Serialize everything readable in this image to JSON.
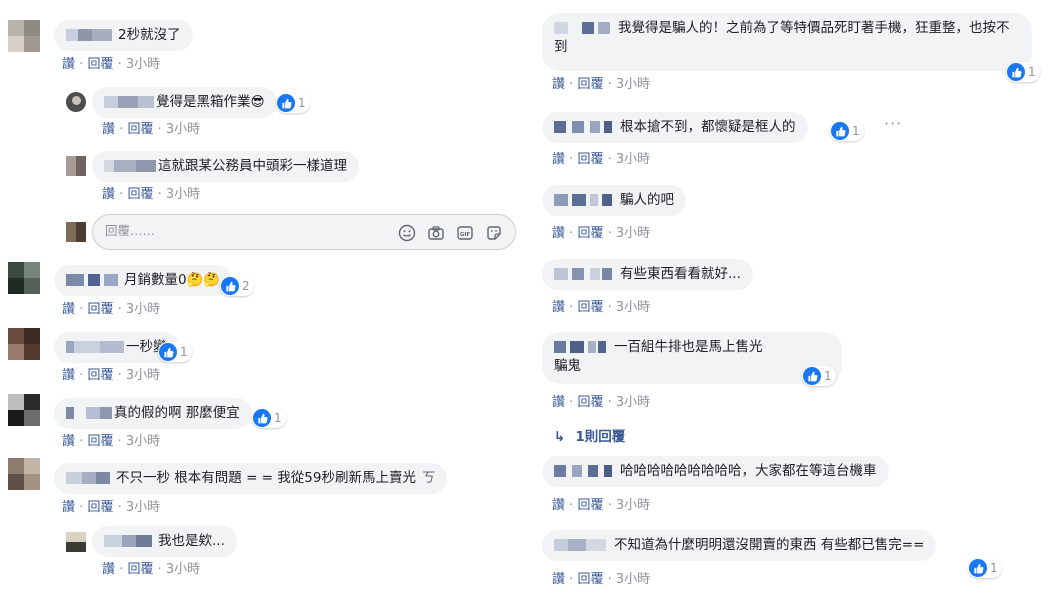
{
  "labels": {
    "like": "讚",
    "reply": "回覆",
    "sep": "·"
  },
  "reply_input": {
    "placeholder": "回覆……"
  },
  "left": [
    {
      "text": "2秒就沒了",
      "time": "3小時",
      "reactions": ""
    },
    {
      "text": "覺得是黑箱作業😎",
      "time": "3小時",
      "reactions": "1"
    },
    {
      "text": "這就跟某公務員中頭彩一樣道理",
      "time": "3小時",
      "reactions": ""
    },
    {
      "text": "月銷數量0🤔🤔",
      "time": "3小時",
      "reactions": "2"
    },
    {
      "text": "一秒變",
      "time": "3小時",
      "reactions": "1"
    },
    {
      "text": "真的假的啊 那麼便宜",
      "time": "3小時",
      "reactions": "1"
    },
    {
      "text": "不只一秒 根本有問題 = = 我從59秒刷新馬上賣光",
      "time": "3小時",
      "reactions": ""
    },
    {
      "text": "我也是欸...",
      "time": "3小時",
      "reactions": ""
    }
  ],
  "right": [
    {
      "text": "我覺得是騙人的！之前為了等特價品死盯著手機，狂重整，也按不到",
      "time": "3小時",
      "reactions": "1"
    },
    {
      "text": "根本搶不到，都懷疑是框人的",
      "time": "3小時",
      "reactions": "1"
    },
    {
      "text": "騙人的吧",
      "time": "3小時",
      "reactions": ""
    },
    {
      "text": "有些東西看看就好...",
      "time": "3小時",
      "reactions": ""
    },
    {
      "text": "一百組牛排也是馬上售光",
      "text2": "騙鬼",
      "time": "3小時",
      "reactions": "1"
    },
    {
      "text": "哈哈哈哈哈哈哈哈哈，大家都在等這台機車",
      "time": "3小時",
      "reactions": ""
    },
    {
      "text": "不知道為什麼明明還沒開賣的東西 有些都已售完==",
      "time": "3小時",
      "reactions": "1"
    }
  ],
  "replies_link": "1則回覆",
  "colors": {
    "link": "#385898",
    "meta": "#90949c",
    "bubble": "#f2f3f5",
    "like_blue": "#1877f2"
  },
  "icons": [
    "emoji-icon",
    "camera-icon",
    "gif-icon",
    "sticker-icon",
    "reply-arrow-icon",
    "thumbs-up-icon",
    "more-options-icon"
  ]
}
